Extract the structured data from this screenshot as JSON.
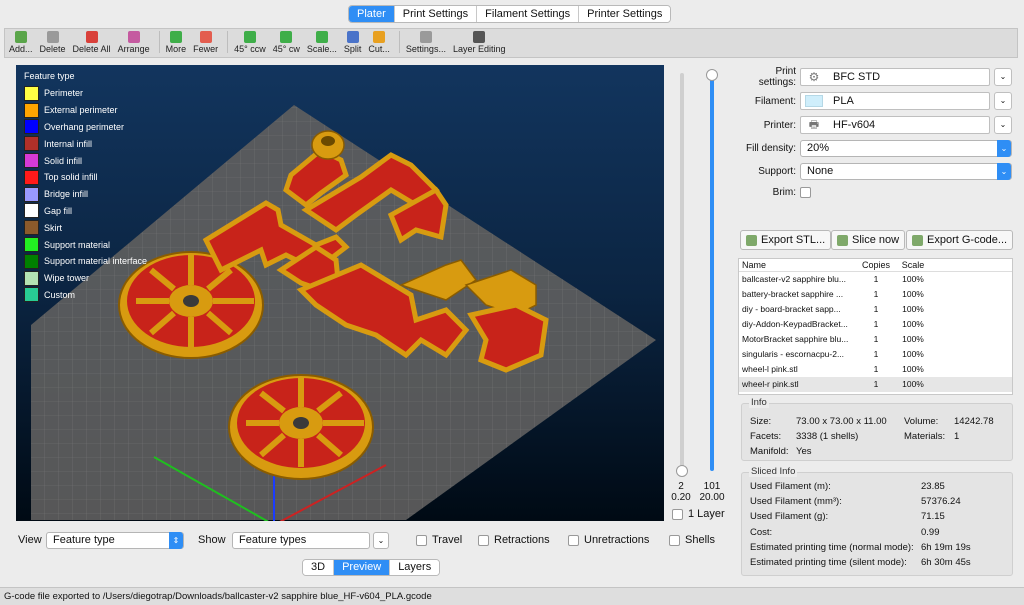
{
  "tabs": [
    {
      "label": "Plater",
      "active": true
    },
    {
      "label": "Print Settings",
      "active": false
    },
    {
      "label": "Filament Settings",
      "active": false
    },
    {
      "label": "Printer Settings",
      "active": false
    }
  ],
  "toolbar": [
    {
      "label": "Add...",
      "icon": "add-icon",
      "color": "#5aa54a"
    },
    {
      "label": "Delete",
      "icon": "delete-icon",
      "color": "#9a9a9a"
    },
    {
      "label": "Delete All",
      "icon": "delete-all-icon",
      "color": "#d9403a"
    },
    {
      "label": "Arrange",
      "icon": "arrange-icon",
      "color": "#c55aa0"
    },
    {
      "label": "More",
      "icon": "more-icon",
      "color": "#3fae49"
    },
    {
      "label": "Fewer",
      "icon": "fewer-icon",
      "color": "#e35d4f"
    },
    {
      "label": "45° ccw",
      "icon": "rotate-ccw-icon",
      "color": "#3fae49"
    },
    {
      "label": "45° cw",
      "icon": "rotate-cw-icon",
      "color": "#3fae49"
    },
    {
      "label": "Scale...",
      "icon": "scale-icon",
      "color": "#3fae49"
    },
    {
      "label": "Split",
      "icon": "split-icon",
      "color": "#4a73c9"
    },
    {
      "label": "Cut...",
      "icon": "cut-icon",
      "color": "#e8a020"
    },
    {
      "label": "Settings...",
      "icon": "settings-icon",
      "color": "#9a9a9a"
    },
    {
      "label": "Layer Editing",
      "icon": "layer-editing-icon",
      "color": "#555555"
    }
  ],
  "legend": {
    "title": "Feature type",
    "items": [
      {
        "label": "Perimeter",
        "color": "#ffff44"
      },
      {
        "label": "External perimeter",
        "color": "#ffa500"
      },
      {
        "label": "Overhang perimeter",
        "color": "#0000ff"
      },
      {
        "label": "Internal infill",
        "color": "#b03029"
      },
      {
        "label": "Solid infill",
        "color": "#d63ad6"
      },
      {
        "label": "Top solid infill",
        "color": "#ff1a1a"
      },
      {
        "label": "Bridge infill",
        "color": "#9999ff"
      },
      {
        "label": "Gap fill",
        "color": "#ffffff"
      },
      {
        "label": "Skirt",
        "color": "#8b5a2b"
      },
      {
        "label": "Support material",
        "color": "#22ee22"
      },
      {
        "label": "Support material interface",
        "color": "#008000"
      },
      {
        "label": "Wipe tower",
        "color": "#b3e3b3"
      },
      {
        "label": "Custom",
        "color": "#28cc94"
      }
    ]
  },
  "layers": {
    "top_layer": "101",
    "top_height": "20.00",
    "bottom_layer": "2",
    "bottom_height": "0.20",
    "one_layer_label": "1 Layer"
  },
  "view_bar": {
    "view_label": "View",
    "view_value": "Feature type",
    "show_label": "Show",
    "show_value": "Feature types",
    "checks": [
      "Travel",
      "Retractions",
      "Unretractions",
      "Shells"
    ]
  },
  "view_tabs": [
    {
      "label": "3D",
      "active": false
    },
    {
      "label": "Preview",
      "active": true
    },
    {
      "label": "Layers",
      "active": false
    }
  ],
  "settings": {
    "print_label": "Print settings:",
    "print_value": "BFC STD",
    "filament_label": "Filament:",
    "filament_value": "PLA",
    "filament_color": "#cfeefb",
    "printer_label": "Printer:",
    "printer_value": "HF-v604",
    "fill_label": "Fill density:",
    "fill_value": "20%",
    "support_label": "Support:",
    "support_value": "None",
    "brim_label": "Brim:"
  },
  "actions": {
    "export_stl": "Export STL...",
    "slice_now": "Slice now",
    "export_gcode": "Export G-code..."
  },
  "objects": {
    "headers": [
      "Name",
      "Copies",
      "Scale"
    ],
    "rows": [
      {
        "name": "ballcaster-v2 sapphire blu...",
        "copies": "1",
        "scale": "100%"
      },
      {
        "name": "battery-bracket sapphire ...",
        "copies": "1",
        "scale": "100%"
      },
      {
        "name": "diy - board-bracket sapp...",
        "copies": "1",
        "scale": "100%"
      },
      {
        "name": "diy-Addon-KeypadBracket...",
        "copies": "1",
        "scale": "100%"
      },
      {
        "name": "MotorBracket sapphire blu...",
        "copies": "1",
        "scale": "100%"
      },
      {
        "name": "singularis - escornacpu-2...",
        "copies": "1",
        "scale": "100%"
      },
      {
        "name": "wheel-l pink.stl",
        "copies": "1",
        "scale": "100%"
      },
      {
        "name": "wheel-r pink.stl",
        "copies": "1",
        "scale": "100%"
      }
    ]
  },
  "info": {
    "title": "Info",
    "size_label": "Size:",
    "size_value": "73.00 x 73.00 x 11.00",
    "volume_label": "Volume:",
    "volume_value": "14242.78",
    "facets_label": "Facets:",
    "facets_value": "3338 (1 shells)",
    "materials_label": "Materials:",
    "materials_value": "1",
    "manifold_label": "Manifold:",
    "manifold_value": "Yes"
  },
  "sliced": {
    "title": "Sliced Info",
    "rows": [
      {
        "label": "Used Filament (m):",
        "value": "23.85"
      },
      {
        "label": "Used Filament (mm³):",
        "value": "57376.24"
      },
      {
        "label": "Used Filament (g):",
        "value": "71.15"
      },
      {
        "label": "Cost:",
        "value": "0.99"
      },
      {
        "label": "Estimated printing time (normal mode):",
        "value": "6h 19m 19s"
      },
      {
        "label": "Estimated printing time (silent mode):",
        "value": "6h 30m 45s"
      }
    ]
  },
  "status": "G-code file exported to /Users/diegotrap/Downloads/ballcaster-v2 sapphire blue_HF-v604_PLA.gcode"
}
